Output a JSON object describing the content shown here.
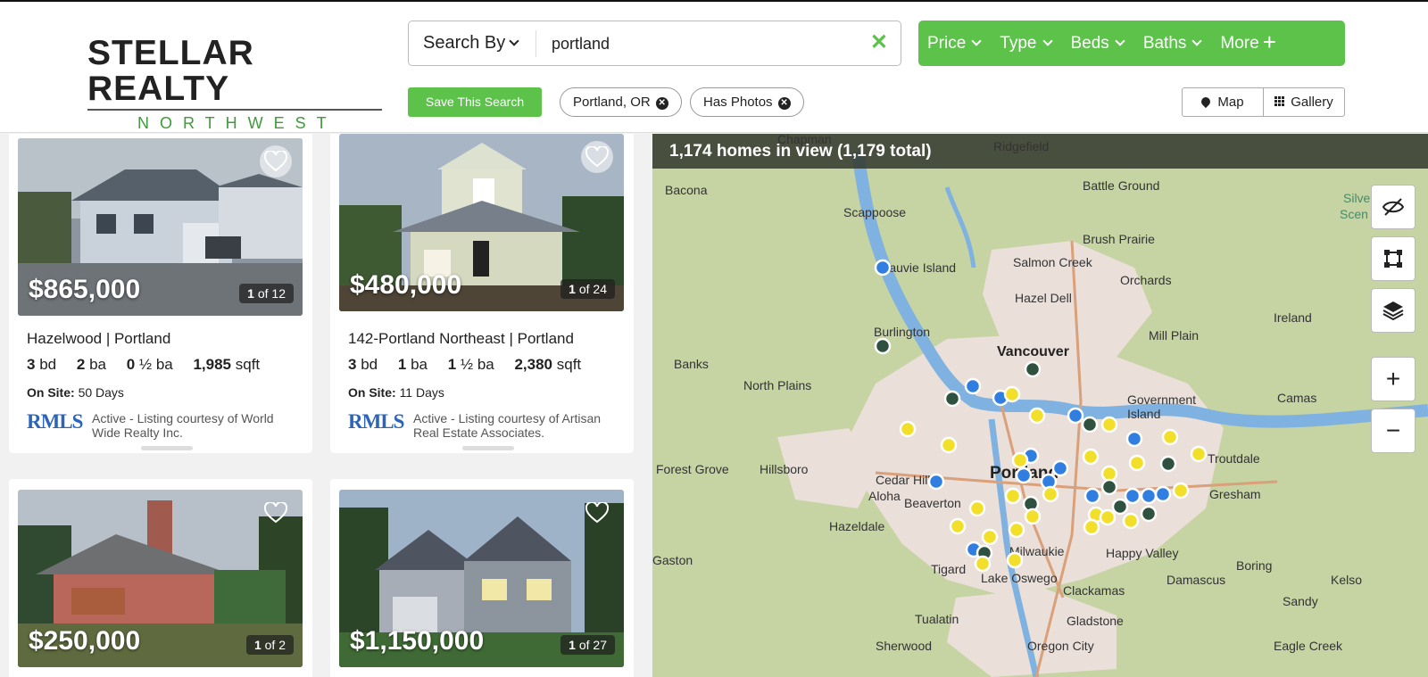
{
  "logo": {
    "main": "STELLAR REALTY",
    "sub": "NORTHWEST"
  },
  "search": {
    "by_label": "Search By",
    "value": "portland",
    "clear": "✕"
  },
  "filters": {
    "price": "Price",
    "type": "Type",
    "beds": "Beds",
    "baths": "Baths",
    "more": "More"
  },
  "save_search": "Save This Search",
  "chips": [
    {
      "label": "Portland, OR"
    },
    {
      "label": "Has Photos"
    }
  ],
  "view_toggle": {
    "map": "Map",
    "gallery": "Gallery"
  },
  "listings": [
    {
      "price": "$865,000",
      "photo_index": "1",
      "photo_total": "of 12",
      "title": "Hazelwood | Portland",
      "beds": "3",
      "beds_unit": "bd",
      "baths": "2",
      "baths_unit": "ba",
      "half_baths": "0",
      "half_unit": "½ ba",
      "sqft": "1,985",
      "sqft_unit": "sqft",
      "onsite_label": "On Site:",
      "onsite_value": "50 Days",
      "rmls": "RMLS",
      "courtesy": "Active - Listing courtesy of World Wide Realty Inc."
    },
    {
      "price": "$480,000",
      "photo_index": "1",
      "photo_total": "of 24",
      "title": "142-Portland Northeast | Portland",
      "beds": "3",
      "beds_unit": "bd",
      "baths": "1",
      "baths_unit": "ba",
      "half_baths": "1",
      "half_unit": "½ ba",
      "sqft": "2,380",
      "sqft_unit": "sqft",
      "onsite_label": "On Site:",
      "onsite_value": "11 Days",
      "rmls": "RMLS",
      "courtesy": "Active - Listing courtesy of Artisan Real Estate Associates."
    },
    {
      "price": "$250,000",
      "photo_index": "1",
      "photo_total": "of 2"
    },
    {
      "price": "$1,150,000",
      "photo_index": "1",
      "photo_total": "of 27"
    }
  ],
  "map": {
    "banner": "1,174 homes in view (1,179 total)",
    "labels": {
      "bacona": "Bacona",
      "chapman": "Chapman",
      "ridgefield": "Ridgefield",
      "battle_ground": "Battle Ground",
      "scappoose": "Scappoose",
      "brush_prairie": "Brush Prairie",
      "sauvie": "Sauvie Island",
      "salmon_creek": "Salmon Creek",
      "orchards": "Orchards",
      "hazel_dell": "Hazel Dell",
      "ireland": "Ireland",
      "burlington": "Burlington",
      "mill_plain": "Mill Plain",
      "vancouver": "Vancouver",
      "banks": "Banks",
      "north_plains": "North Plains",
      "camas": "Camas",
      "government_island": "Government Island",
      "forest_grove": "Forest Grove",
      "hillsboro": "Hillsboro",
      "troutdale": "Troutdale",
      "portland": "Portland",
      "cedar_hills": "Cedar Hills",
      "aloha": "Aloha",
      "beaverton": "Beaverton",
      "gresham": "Gresham",
      "hazeldale": "Hazeldale",
      "gaston": "Gaston",
      "tigard": "Tigard",
      "milwaukie": "Milwaukie",
      "happy_valley": "Happy Valley",
      "boring": "Boring",
      "lake_oswego": "Lake Oswego",
      "damascus": "Damascus",
      "kelso": "Kelso",
      "clackamas": "Clackamas",
      "sandy": "Sandy",
      "tualatin": "Tualatin",
      "gladstone": "Gladstone",
      "sherwood": "Sherwood",
      "oregon_city": "Oregon City",
      "eagle_creek": "Eagle Creek",
      "silver": "Silve",
      "scenic": "Scen"
    },
    "zoom_in": "+",
    "zoom_out": "−"
  }
}
